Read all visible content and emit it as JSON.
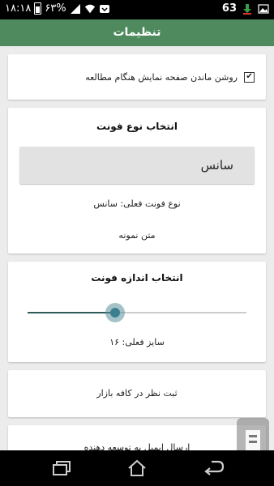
{
  "status_bar": {
    "time": "۱۸:۱۸",
    "battery": "۶۳%",
    "notification_count": "63"
  },
  "app_bar": {
    "title": "تنظیمات"
  },
  "keep_screen_on": {
    "label": "روشن ماندن صفحه نمایش هنگام مطالعه",
    "checked": true
  },
  "font_type": {
    "title": "انتخاب نوع فونت",
    "selected": "سانس",
    "current_label": "نوع فونت فعلی: سانس",
    "sample_text": "متن نمونه"
  },
  "font_size": {
    "title": "انتخاب اندازه فونت",
    "value_fraction": 0.4,
    "current_label": "سایز فعلی: ۱۶"
  },
  "rate_app": {
    "label": "ثبت نظر در کافه بازار"
  },
  "contact_dev": {
    "label": "ارسال ایمیل به توسعه دهنده"
  },
  "colors": {
    "app_bar": "#4e8a5e",
    "slider_fill": "#2e5a59",
    "slider_thumb": "#3b7f8f"
  }
}
